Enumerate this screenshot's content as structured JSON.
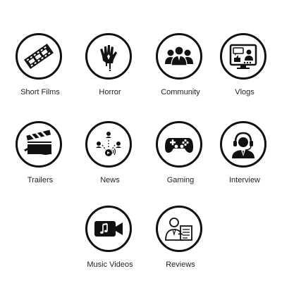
{
  "categories": [
    {
      "label": "Short Films",
      "icon": "film-strip-icon"
    },
    {
      "label": "Horror",
      "icon": "bloody-hand-icon"
    },
    {
      "label": "Community",
      "icon": "people-group-icon"
    },
    {
      "label": "Vlogs",
      "icon": "vlog-screen-icon"
    },
    {
      "label": "Trailers",
      "icon": "clapperboard-icon"
    },
    {
      "label": "News",
      "icon": "news-broadcast-icon"
    },
    {
      "label": "Gaming",
      "icon": "gamepad-icon"
    },
    {
      "label": "Interview",
      "icon": "headset-person-icon"
    },
    {
      "label": "Music Videos",
      "icon": "music-video-camera-icon"
    },
    {
      "label": "Reviews",
      "icon": "person-document-icon"
    }
  ],
  "colors": {
    "ink": "#111111",
    "background": "#ffffff"
  }
}
